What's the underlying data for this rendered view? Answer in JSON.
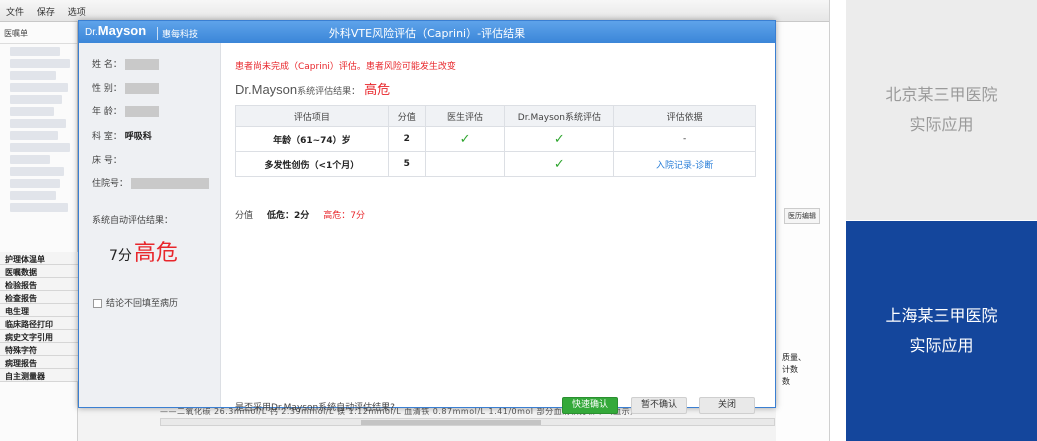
{
  "background_app": {
    "toolbar": [
      "文件",
      "保存",
      "选项"
    ],
    "tree_label": "医嘱单",
    "side_items": [
      "护理体温单",
      "医嘱数据",
      "检验报告",
      "检查报告",
      "电生理",
      "临床路径打印",
      "病史文字引用",
      "特殊字符",
      "病理报告",
      "自主测量器"
    ],
    "right_button": "医历编辑",
    "right_text": [
      "质量、",
      "计数",
      "数"
    ],
    "bottom_text": "——二氧化碳 26.3mmol/L 钙 2.39mmol/L 镁 1.12mmol/L 血清铁 0.87mmol/L 1.41/0mol 部分血清铁分析中（血示）"
  },
  "dialog": {
    "logo_prefix": "Dr.",
    "logo_name": "Mayson",
    "logo_sub": "惠每科技",
    "title": "外科VTE风险评估（Caprini）-评估结果",
    "patient": {
      "name_label": "姓 名：",
      "sex_label": "性 别：",
      "age_label": "年 龄：",
      "dept_label": "科 室：",
      "dept_value": "呼吸科",
      "bed_label": "床 号：",
      "admission_label": "住院号："
    },
    "auto_result_label": "系统自动评估结果：",
    "auto_score": "7分",
    "auto_level": "高危",
    "checkbox_label": "结论不回填至病历",
    "warning": "患者尚未完成（Caprini）评估。患者风险可能发生改变",
    "result_brand": "Dr.Mayson",
    "result_label": "系统评估结果：",
    "result_level": "高危",
    "table": {
      "headers": [
        "评估项目",
        "分值",
        "医生评估",
        "Dr.Mayson系统评估",
        "评估依据"
      ],
      "rows": [
        {
          "item": "年龄（61~74）岁",
          "score": "2",
          "doctor": "✓",
          "system": "✓",
          "basis": "-",
          "basis_link": false
        },
        {
          "item": "多发性创伤（<1个月）",
          "score": "5",
          "doctor": "",
          "system": "✓",
          "basis": "入院记录-诊断",
          "basis_link": true
        }
      ]
    },
    "legend": {
      "label": "分值",
      "low": "低危：2分",
      "high": "高危：7分"
    },
    "question": "是否采用Dr.Mayson系统自动评估结果?",
    "buttons": {
      "confirm": "快速确认",
      "later": "暂不确认",
      "close": "关闭"
    }
  },
  "panels": {
    "beijing": {
      "line1": "北京某三甲医院",
      "line2": "实际应用"
    },
    "shanghai": {
      "line1": "上海某三甲医院",
      "line2": "实际应用"
    }
  },
  "colors": {
    "title_bar": "#3b86d8",
    "danger": "#e8262b",
    "success": "#34a93a",
    "link": "#2a7fd8",
    "panel_active": "#14469c",
    "panel_inactive": "#ececec"
  }
}
